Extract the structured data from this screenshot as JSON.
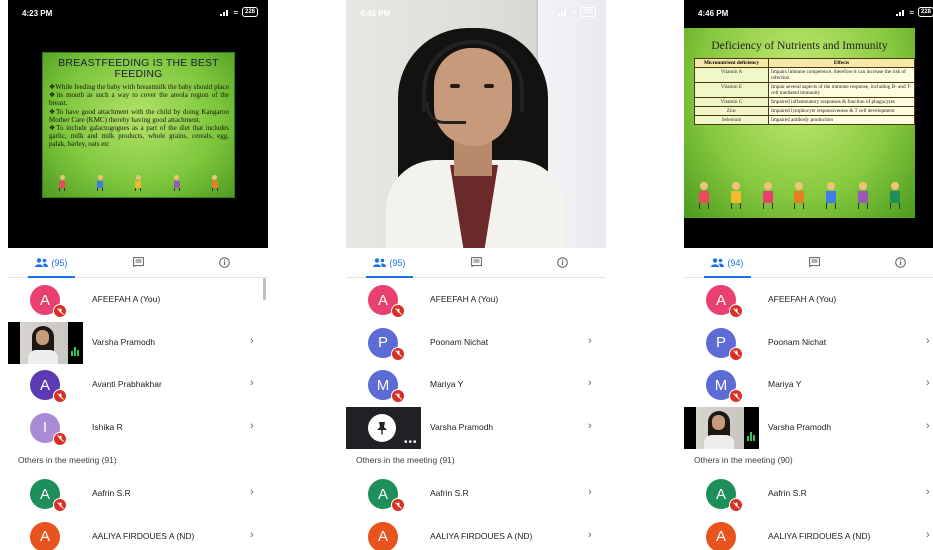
{
  "colors": {
    "accent": "#1a73e8",
    "mute": "#d93025",
    "avatar_pink": "#e8406f",
    "avatar_purple": "#5c3bb2",
    "avatar_lavender": "#a98bd6",
    "avatar_indigo": "#5d6bd5",
    "avatar_green": "#1e8e5a",
    "avatar_orange": "#e8541e"
  },
  "icons": {
    "people": "people-icon",
    "chat": "chat-icon",
    "info": "info-icon",
    "mute": "mic-off-icon",
    "chevron": "chevron-right-icon",
    "pin": "pin-icon"
  },
  "screens": [
    {
      "time": "4:23 PM",
      "battery": "228",
      "slide": {
        "title": "BREASTFEEDING IS THE BEST FEEDING",
        "points": [
          "❖While feeding the baby with breastmilk the baby should place",
          "❖its mouth as such a way to cover the areola region of the breast.",
          "❖To have good attachment with the child by doing Kangaroo Mother Care (KMC) thereby having good attachment.",
          "❖To include galactogogues as a part of the diet that includes garlic, milk and milk products, whole grains, cereals, egg, palak, barley, oats etc"
        ]
      },
      "people_count": "(95)",
      "participants": [
        {
          "initial": "A",
          "name": "AFEEFAH A (You)"
        },
        {
          "name": "Varsha Pramodh"
        },
        {
          "initial": "A",
          "name": "Avanti Prabhakhar"
        },
        {
          "initial": "I",
          "name": "Ishika R"
        }
      ],
      "others_label": "Others in the meeting (91)",
      "others": [
        {
          "initial": "A",
          "name": "Aafrin S.R"
        },
        {
          "initial": "A",
          "name": "AALIYA FIRDOUES A (ND)"
        }
      ]
    },
    {
      "time": "4:45 PM",
      "battery": "228",
      "people_count": "(95)",
      "participants": [
        {
          "initial": "A",
          "name": "AFEEFAH A (You)"
        },
        {
          "initial": "P",
          "name": "Poonam Nichat"
        },
        {
          "initial": "M",
          "name": "Mariya Y"
        },
        {
          "name": "Varsha Pramodh"
        }
      ],
      "others_label": "Others in the meeting (91)",
      "others": [
        {
          "initial": "A",
          "name": "Aafrin S.R"
        },
        {
          "initial": "A",
          "name": "AALIYA FIRDOUES A (ND)"
        }
      ]
    },
    {
      "time": "4:46 PM",
      "battery": "228",
      "slide": {
        "title": "Deficiency of Nutrients and Immunity",
        "headers": [
          "Micronutrient deficiency",
          "Effects"
        ],
        "rows": [
          [
            "Vitamin A",
            "Impairs immune competence, therefore it can increase the risk of infection"
          ],
          [
            "Vitamin E",
            "Impair several aspects of the immune response, including B- and T-cell mediated immunity"
          ],
          [
            "Vitamin C",
            "Impaired inflammatory responses & function of phagocytes"
          ],
          [
            "Zinc",
            "Impaired lymphocyte responsiveness & T cell development"
          ],
          [
            "Selenium",
            "Impaired antibody production"
          ]
        ]
      },
      "people_count": "(94)",
      "participants": [
        {
          "initial": "A",
          "name": "AFEEFAH A (You)"
        },
        {
          "initial": "P",
          "name": "Poonam Nichat"
        },
        {
          "initial": "M",
          "name": "Mariya Y"
        },
        {
          "name": "Varsha Pramodh"
        }
      ],
      "others_label": "Others in the meeting (90)",
      "others": [
        {
          "initial": "A",
          "name": "Aafrin S.R"
        },
        {
          "initial": "A",
          "name": "AALIYA FIRDOUES A (ND)"
        }
      ]
    }
  ]
}
